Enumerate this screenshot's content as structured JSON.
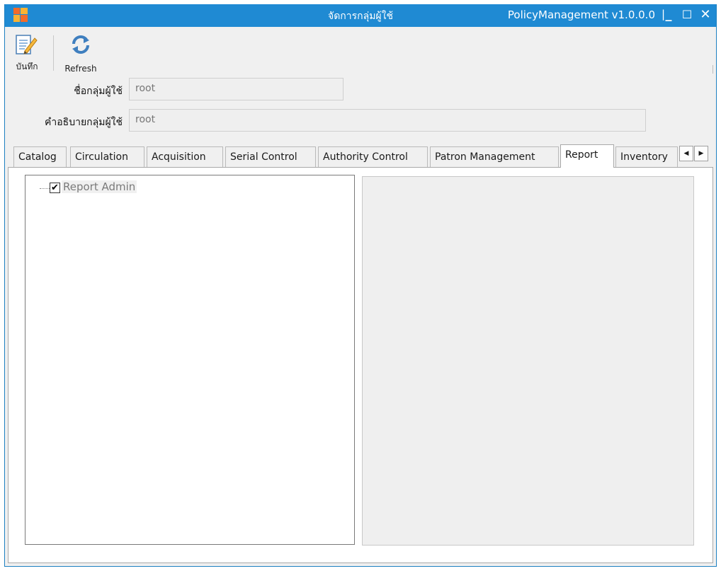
{
  "window": {
    "title": "จัดการกลุ่มผู้ใช้",
    "app_version": "PolicyManagement v1.0.0.0",
    "separator": "|",
    "minimize_glyph": "_",
    "maximize_glyph": "☐",
    "close_glyph": "✕",
    "accent_color": "#1f8ad3"
  },
  "toolbar": {
    "save_label": "บันทึก",
    "refresh_label": "Refresh",
    "save_icon": "edit-document-icon",
    "refresh_icon": "refresh-icon"
  },
  "form": {
    "group_name_label": "ชื่อกลุ่มผู้ใช้",
    "group_name_value": "root",
    "group_desc_label": "คำอธิบายกลุ่มผู้ใช้",
    "group_desc_value": "root"
  },
  "tabs": [
    {
      "label": "Catalog"
    },
    {
      "label": "Circulation"
    },
    {
      "label": "Acquisition"
    },
    {
      "label": "Serial Control"
    },
    {
      "label": "Authority Control"
    },
    {
      "label": "Patron Management"
    },
    {
      "label": "Report"
    },
    {
      "label": "Inventory"
    }
  ],
  "active_tab": "Report",
  "tab_scroll": {
    "left": "◀",
    "right": "▶"
  },
  "tree": {
    "nodes": [
      {
        "label": "Report Admin",
        "checked": true,
        "check_glyph": "✔"
      }
    ]
  }
}
